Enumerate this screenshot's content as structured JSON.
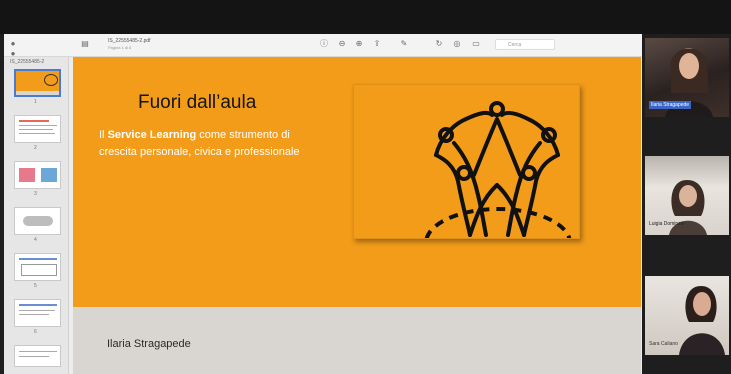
{
  "viewer": {
    "file_name": "IS_22555485-2.pdf",
    "file_subtitle": "Pagina 1 di 8",
    "search_placeholder": "Cerca",
    "sidebar_header": "IS_22555485-2",
    "page_numbers": [
      "1",
      "2",
      "3",
      "4",
      "5",
      "6",
      "7"
    ]
  },
  "slide": {
    "title": "Fuori dall’aula",
    "body_prefix": "Il ",
    "body_bold": "Service Learning",
    "body_rest": " come strumento di crescita personale, civica e professionale",
    "author": "Ilaria Stragapede",
    "colors": {
      "background": "#F39C1A",
      "footer": "#d9d6d1"
    }
  },
  "participants": [
    {
      "name": "Ilaria Stragapede",
      "highlighted": true
    },
    {
      "name": "Luigia Dominzio",
      "highlighted": false
    },
    {
      "name": "Sara Caliano",
      "highlighted": false
    }
  ],
  "icons": [
    "sidebar-toggle-icon",
    "info-icon",
    "zoom-out-icon",
    "zoom-in-icon",
    "share-icon",
    "markup-icon",
    "rotate-icon",
    "annotate-icon",
    "search-icon",
    "people-circle-icon"
  ]
}
